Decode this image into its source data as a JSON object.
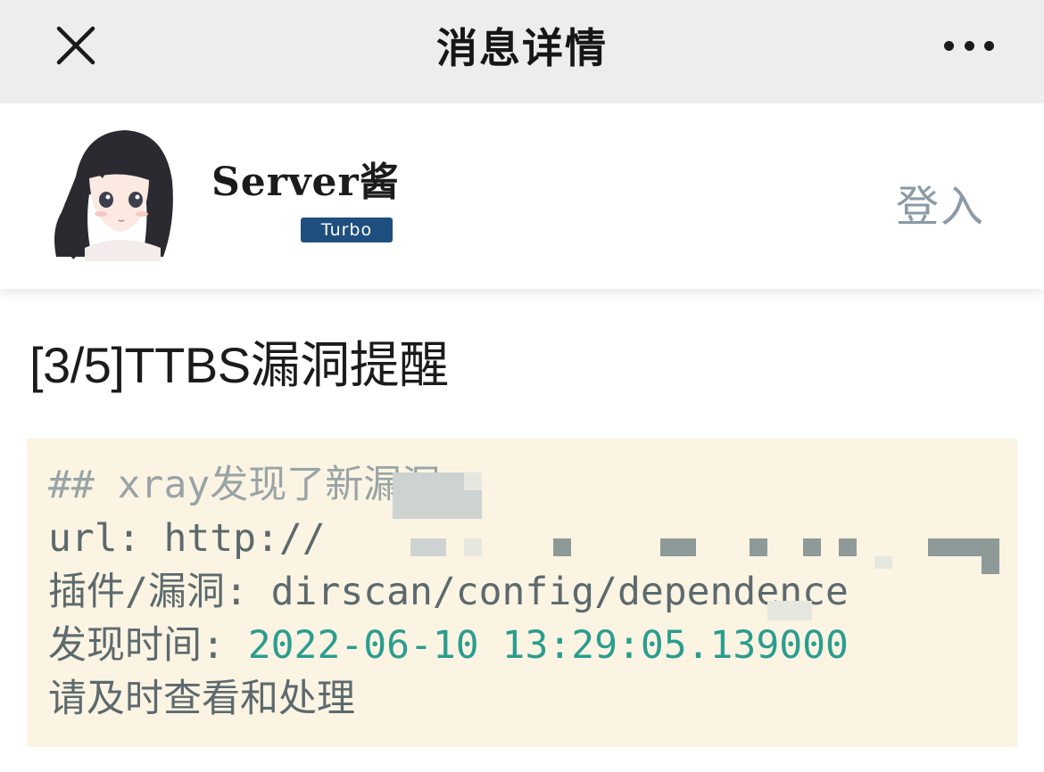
{
  "navbar": {
    "title": "消息详情",
    "close_icon": "close-icon",
    "more_icon": "more-dots-icon"
  },
  "profile": {
    "name": "Server酱",
    "badge": "Turbo",
    "login_label": "登入",
    "avatar": "anime-girl-avatar"
  },
  "message": {
    "title": "[3/5]TTBS漏洞提醒",
    "lines": {
      "heading": "## xray发现了新漏洞",
      "url_label": "url: http://",
      "plugin": "插件/漏洞: dirscan/config/dependence",
      "time_label": "发现时间: ",
      "time_value": "2022-06-10 13:29:05.139000",
      "action": "请及时查看和处理"
    }
  },
  "colors": {
    "navbar_bg": "#ededed",
    "badge_bg": "#1f4f7e",
    "code_bg": "#fbf4e2",
    "number_color": "#2a9d8f",
    "login_color": "#8a9aa6"
  }
}
